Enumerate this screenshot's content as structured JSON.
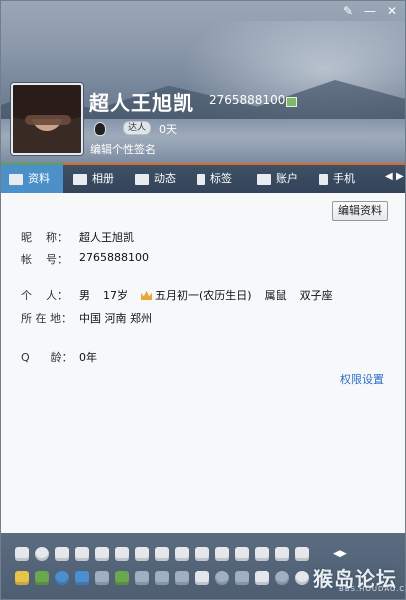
{
  "header": {
    "nickname": "超人王旭凯",
    "qq_number": "2765888100",
    "level_badge": "达人",
    "level_days": "0天",
    "signature_placeholder": "编辑个性签名"
  },
  "window_buttons": [
    "✎",
    "—",
    "✕"
  ],
  "tabs": [
    {
      "label": "资料",
      "icon": "profile-card-icon"
    },
    {
      "label": "相册",
      "icon": "photo-album-icon"
    },
    {
      "label": "动态",
      "icon": "feed-icon"
    },
    {
      "label": "标签",
      "icon": "bookmark-icon"
    },
    {
      "label": "账户",
      "icon": "wallet-icon"
    },
    {
      "label": "手机",
      "icon": "phone-icon"
    }
  ],
  "content": {
    "edit_button": "编辑资料",
    "fields": {
      "nickname_label": "昵    称：",
      "nickname_value": "超人王旭凯",
      "account_label": "帐    号：",
      "account_value": "2765888100",
      "personal_label": "个    人：",
      "gender": "男",
      "age": "17岁",
      "birthday": "五月初一(农历生日)",
      "zodiac_cn": "属鼠",
      "zodiac": "双子座",
      "location_label": "所 在 地：",
      "location_value": "中国 河南 郑州",
      "qq_age_label": "Q      龄：",
      "qq_age_value": "0年"
    },
    "permission_link": "权限设置"
  },
  "watermark": {
    "logo": "猴岛论坛",
    "url": "BBS.HOUDAO.COM"
  },
  "colors": {
    "tab_active": "#4b90c8",
    "tabbar": "#3f5166",
    "link": "#2a6fc6"
  }
}
